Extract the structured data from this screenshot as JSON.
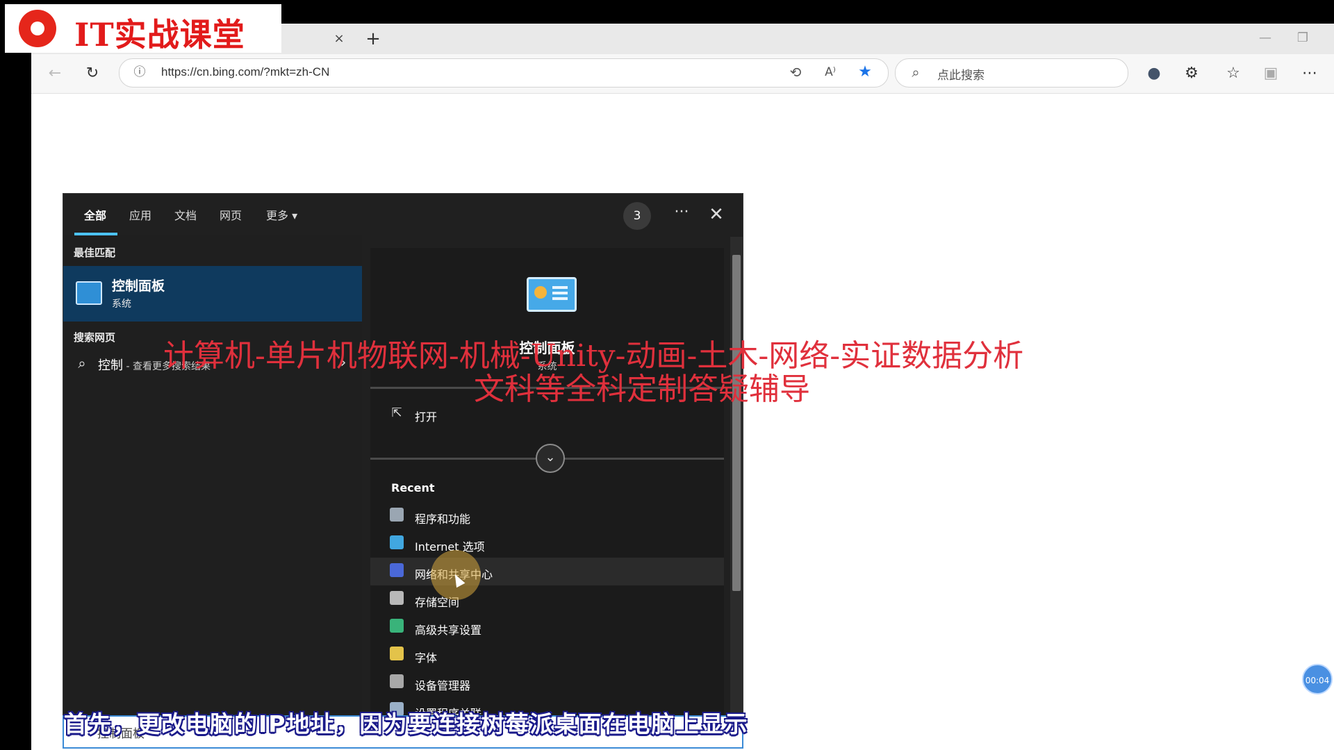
{
  "logo": {
    "text": "IT实战课堂"
  },
  "browser": {
    "tab_close": "×",
    "new_tab": "+",
    "win_min": "—",
    "win_max": "❐",
    "url": "https://cn.bing.com/?mkt=zh-CN",
    "search_placeholder": "点此搜索"
  },
  "panel": {
    "tabs": [
      "全部",
      "应用",
      "文档",
      "网页",
      "更多 ▾"
    ],
    "badge": "3",
    "more": "···",
    "close": "✕",
    "best_match_heading": "最佳匹配",
    "best_match": {
      "title": "控制面板",
      "subtitle": "系统"
    },
    "web_heading": "搜索网页",
    "web_result": {
      "query": "控制",
      "hint": " - 查看更多搜索结果"
    },
    "detail": {
      "title": "控制面板",
      "subtitle": "系统",
      "open_label": "打开"
    },
    "recent_heading": "Recent",
    "recent_items": [
      {
        "label": "程序和功能",
        "color": "#9aa6b2"
      },
      {
        "label": "Internet 选项",
        "color": "#41a7e0"
      },
      {
        "label": "网络和共享中心",
        "color": "#4a68d8"
      },
      {
        "label": "存储空间",
        "color": "#b8b8b8"
      },
      {
        "label": "高级共享设置",
        "color": "#39b37a"
      },
      {
        "label": "字体",
        "color": "#e3c34a"
      },
      {
        "label": "设备管理器",
        "color": "#a8a8a8"
      },
      {
        "label": "设置程序关联",
        "color": "#9ab0c8"
      }
    ],
    "bottom_search": "控制面板"
  },
  "overlay": {
    "line1": "计算机-单片机物联网-机械-Unity-动画-土木-网络-实证数据分析",
    "line2": "文科等全科定制答疑辅导"
  },
  "subtitle": "首先，更改电脑的IP地址，因为要连接树莓派桌面在电脑上显示",
  "timer": "00:04"
}
